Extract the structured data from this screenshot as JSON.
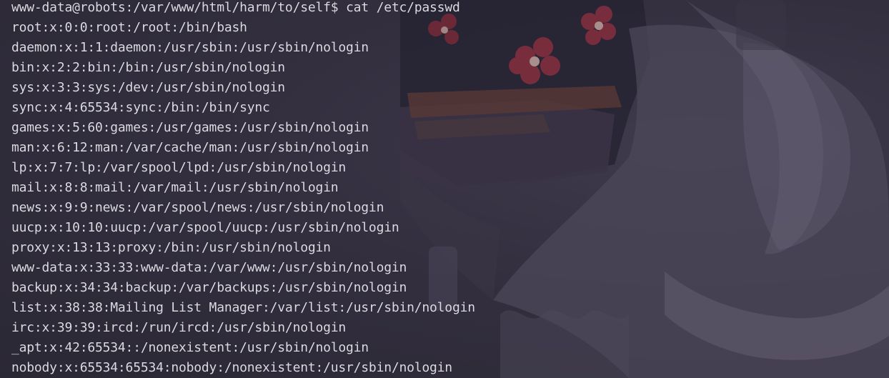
{
  "terminal": {
    "prompt": "www-data@robots:/var/www/html/harm/to/self$",
    "command": "cat /etc/passwd",
    "output_lines": [
      "root:x:0:0:root:/root:/bin/bash",
      "daemon:x:1:1:daemon:/usr/sbin:/usr/sbin/nologin",
      "bin:x:2:2:bin:/bin:/usr/sbin/nologin",
      "sys:x:3:3:sys:/dev:/usr/sbin/nologin",
      "sync:x:4:65534:sync:/bin:/bin/sync",
      "games:x:5:60:games:/usr/games:/usr/sbin/nologin",
      "man:x:6:12:man:/var/cache/man:/usr/sbin/nologin",
      "lp:x:7:7:lp:/var/spool/lpd:/usr/sbin/nologin",
      "mail:x:8:8:mail:/var/mail:/usr/sbin/nologin",
      "news:x:9:9:news:/var/spool/news:/usr/sbin/nologin",
      "uucp:x:10:10:uucp:/var/spool/uucp:/usr/sbin/nologin",
      "proxy:x:13:13:proxy:/bin:/usr/sbin/nologin",
      "www-data:x:33:33:www-data:/var/www:/usr/sbin/nologin",
      "backup:x:34:34:backup:/var/backups:/usr/sbin/nologin",
      "list:x:38:38:Mailing List Manager:/var/list:/usr/sbin/nologin",
      "irc:x:39:39:ircd:/run/ircd:/usr/sbin/nologin",
      "_apt:x:42:65534::/nonexistent:/usr/sbin/nologin",
      "nobody:x:65534:65534:nobody:/nonexistent:/usr/sbin/nologin"
    ]
  },
  "theme": {
    "background": "#2f2c3a",
    "text": "#dcdbe4"
  }
}
